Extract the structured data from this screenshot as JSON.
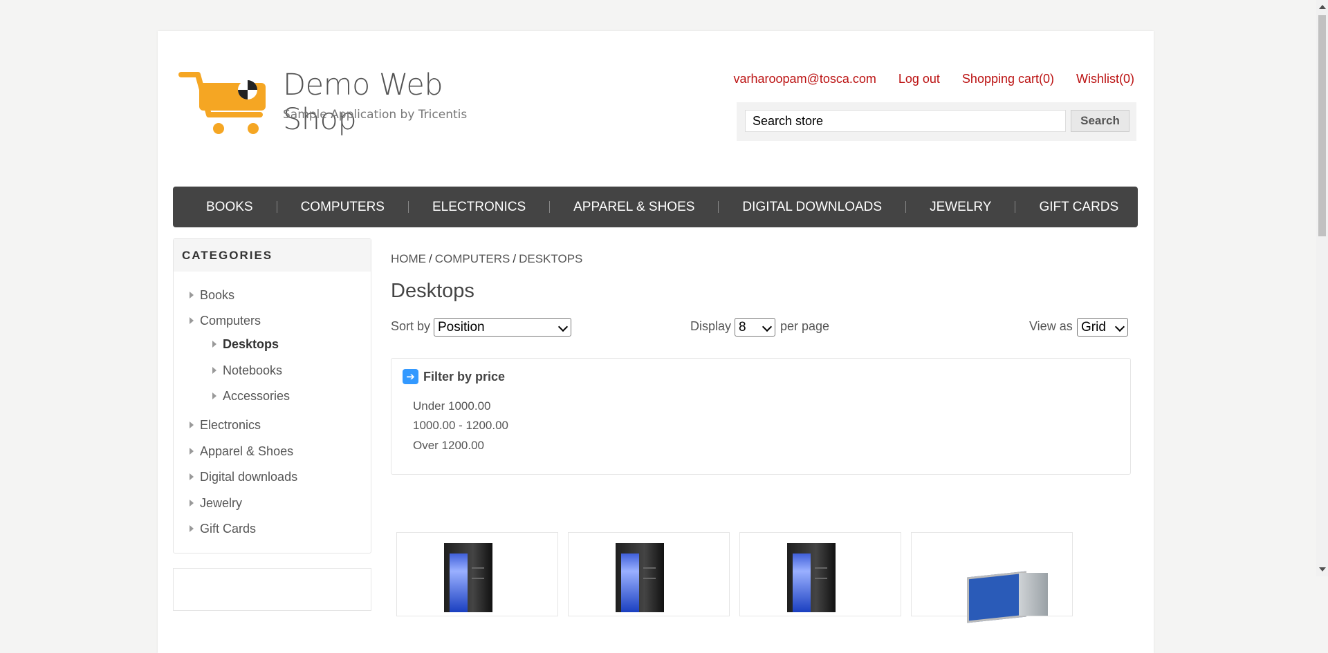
{
  "header": {
    "logo_title": "Demo Web Shop",
    "logo_subtitle": "Sample Application by Tricentis",
    "links": [
      "varharoopam@tosca.com",
      "Log out",
      "Shopping cart(0)",
      "Wishlist(0)"
    ],
    "search_placeholder": "Search store",
    "search_button": "Search"
  },
  "topnav": [
    "BOOKS",
    "COMPUTERS",
    "ELECTRONICS",
    "APPAREL & SHOES",
    "DIGITAL DOWNLOADS",
    "JEWELRY",
    "GIFT CARDS"
  ],
  "sidebar": {
    "title": "CATEGORIES",
    "items": [
      "Books",
      "Computers",
      "Desktops",
      "Notebooks",
      "Accessories",
      "Electronics",
      "Apparel & Shoes",
      "Digital downloads",
      "Jewelry",
      "Gift Cards"
    ],
    "active": "Desktops"
  },
  "breadcrumb": [
    "HOME",
    "COMPUTERS",
    "DESKTOPS"
  ],
  "page_title": "Desktops",
  "options": {
    "sort_label": "Sort by",
    "sort_value": "Position",
    "display_label": "Display",
    "display_value": "8",
    "per_page_label": "per page",
    "view_label": "View as",
    "view_value": "Grid"
  },
  "filter": {
    "title": "Filter by price",
    "ranges": [
      "Under 1000.00",
      "1000.00 - 1200.00",
      "Over 1200.00"
    ]
  },
  "colors": {
    "accent_link": "#b11111",
    "nav_bg": "#444444",
    "filter_icon": "#3399ff"
  }
}
